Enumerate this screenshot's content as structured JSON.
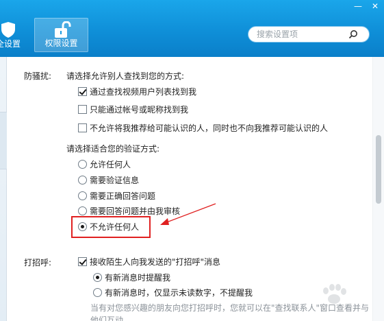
{
  "header": {
    "tabs": [
      {
        "label": "全设置",
        "icon": "shield-icon"
      },
      {
        "label": "权限设置",
        "icon": "unlock-icon",
        "active": true
      }
    ],
    "search": {
      "placeholder": "搜索设置项",
      "icon": "search-icon"
    },
    "window_controls": {
      "minimize": "—",
      "close": "✕"
    }
  },
  "anti_harass": {
    "label": "防骚扰:",
    "find_prompt": "请选择允许别人查找到您的方式:",
    "find_options": [
      {
        "label": "通过查找视频用户列表找到我",
        "checked": true
      },
      {
        "label": "只能通过帐号或昵称找到我",
        "checked": false
      },
      {
        "label": "不允许将我推荐给可能认识的人，同时也不向我推荐可能认识的人",
        "checked": false
      }
    ],
    "verify_prompt": "请选择适合您的验证方式:",
    "verify_options": [
      {
        "label": "允许任何人",
        "selected": false
      },
      {
        "label": "需要验证信息",
        "selected": false
      },
      {
        "label": "需要正确回答问题",
        "selected": false
      },
      {
        "label": "需要回答问题并由我审核",
        "selected": false
      },
      {
        "label": "不允许任何人",
        "selected": true
      }
    ]
  },
  "greeting": {
    "label": "打招呼:",
    "receive": {
      "label": "接收陌生人向我发送的\"打招呼\"消息",
      "checked": true
    },
    "notify_options": [
      {
        "label": "有新消息时提醒我",
        "selected": true
      },
      {
        "label": "有新消息时，仅显示未读数字，不提醒我",
        "selected": false
      }
    ],
    "hint": "当有对您感兴趣的朋友向您打招呼时，您就可以在\"查找联系人\"窗口查看并与他们互动"
  },
  "colors": {
    "header_blue": "#0f8fd8",
    "annotation_red": "#e02020"
  }
}
